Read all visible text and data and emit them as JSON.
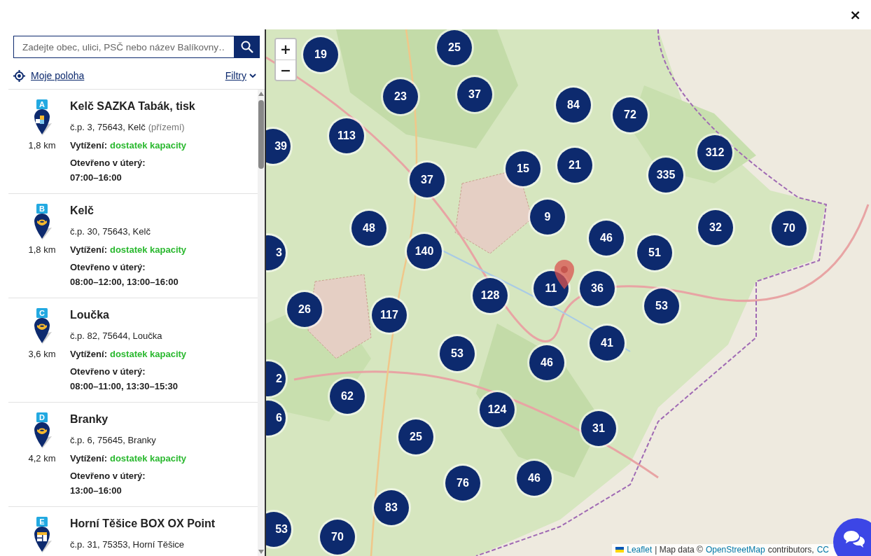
{
  "dialog": {
    "close": "×"
  },
  "search": {
    "placeholder": "Zadejte obec, ulici, PSČ nebo název Balíkovny…"
  },
  "location_link": "Moje poloha",
  "filters": "Filtry",
  "branches": [
    {
      "letter": "A",
      "kind": "partner",
      "name": "Kelč SAZKA Tabák, tisk",
      "distance": "1,8 km",
      "address": "č.p. 3, 75643, Kelč",
      "address_note": "(přízemí)",
      "load_label": "Vytížení:",
      "load": "dostatek kapacity",
      "hours_label": "Otevřeno v úterý:",
      "hours": "07:00–16:00"
    },
    {
      "letter": "B",
      "kind": "post",
      "name": "Kelč",
      "distance": "1,8 km",
      "address": "č.p. 30, 75643, Kelč",
      "load_label": "Vytížení:",
      "load": "dostatek kapacity",
      "hours_label": "Otevřeno v úterý:",
      "hours": "08:00–12:00, 13:00–16:00"
    },
    {
      "letter": "C",
      "kind": "post",
      "name": "Loučka",
      "distance": "3,6 km",
      "address": "č.p. 82, 75644, Loučka",
      "load_label": "Vytížení:",
      "load": "dostatek kapacity",
      "hours_label": "Otevřeno v úterý:",
      "hours": "08:00–11:00, 13:30–15:30"
    },
    {
      "letter": "D",
      "kind": "post",
      "name": "Branky",
      "distance": "4,2 km",
      "address": "č.p. 6, 75645, Branky",
      "load_label": "Vytížení:",
      "load": "dostatek kapacity",
      "hours_label": "Otevřeno v úterý:",
      "hours": "13:00–16:00"
    },
    {
      "letter": "E",
      "kind": "box",
      "name": "Horní Těšice BOX OX Point",
      "address": "č.p. 31, 75353, Horní Těšice"
    }
  ],
  "map": {
    "zoom_in": "+",
    "zoom_out": "−",
    "clusters": [
      {
        "count": "19"
      },
      {
        "count": "25"
      },
      {
        "count": "23"
      },
      {
        "count": "37"
      },
      {
        "count": "84"
      },
      {
        "count": "72"
      },
      {
        "count": "113"
      },
      {
        "count": "39"
      },
      {
        "count": "15"
      },
      {
        "count": "21"
      },
      {
        "count": "335"
      },
      {
        "count": "312"
      },
      {
        "count": "37"
      },
      {
        "count": "9"
      },
      {
        "count": "48"
      },
      {
        "count": "46"
      },
      {
        "count": "32"
      },
      {
        "count": "70"
      },
      {
        "count": "3"
      },
      {
        "count": "140"
      },
      {
        "count": "51"
      },
      {
        "count": "11"
      },
      {
        "count": "36"
      },
      {
        "count": "128"
      },
      {
        "count": "26"
      },
      {
        "count": "117"
      },
      {
        "count": "53"
      },
      {
        "count": "41"
      },
      {
        "count": "53"
      },
      {
        "count": "46"
      },
      {
        "count": "2"
      },
      {
        "count": "62"
      },
      {
        "count": "124"
      },
      {
        "count": "6"
      },
      {
        "count": "25"
      },
      {
        "count": "31"
      },
      {
        "count": "76"
      },
      {
        "count": "46"
      },
      {
        "count": "83"
      },
      {
        "count": "53"
      },
      {
        "count": "70"
      }
    ],
    "attribution": [
      {
        "kind": "link",
        "text": "Leaflet"
      },
      {
        "kind": "text",
        "text": "| Map data ©"
      },
      {
        "kind": "link",
        "text": "OpenStreetMap"
      },
      {
        "kind": "text",
        "text": "contributors,"
      },
      {
        "kind": "link",
        "text": "CC"
      }
    ]
  }
}
